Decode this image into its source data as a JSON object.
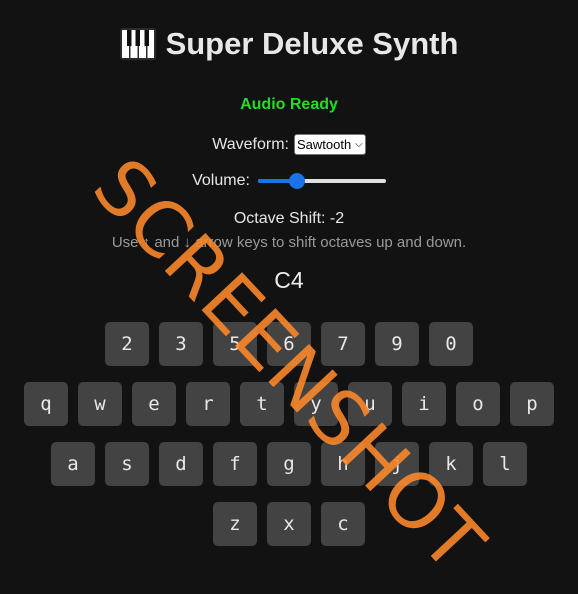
{
  "header": {
    "icon": "piano-keys-icon",
    "title": "Super Deluxe Synth"
  },
  "status": {
    "text": "Audio Ready",
    "color": "#22dd22"
  },
  "waveform": {
    "label": "Waveform:",
    "selected": "Sawtooth"
  },
  "volume": {
    "label": "Volume:",
    "level": 0.28
  },
  "octave": {
    "text": "Octave Shift: -2",
    "hint": "Use ↑ and ↓ arrow keys to shift octaves up and down."
  },
  "current_note": "C4",
  "keyboard": {
    "rows": [
      [
        "2",
        "3",
        "5",
        "6",
        "7",
        "9",
        "0"
      ],
      [
        "q",
        "w",
        "e",
        "r",
        "t",
        "y",
        "u",
        "i",
        "o",
        "p"
      ],
      [
        "a",
        "s",
        "d",
        "f",
        "g",
        "h",
        "j",
        "k",
        "l"
      ],
      [
        "z",
        "x",
        "c"
      ]
    ]
  },
  "watermark": "SCREENSHOT"
}
